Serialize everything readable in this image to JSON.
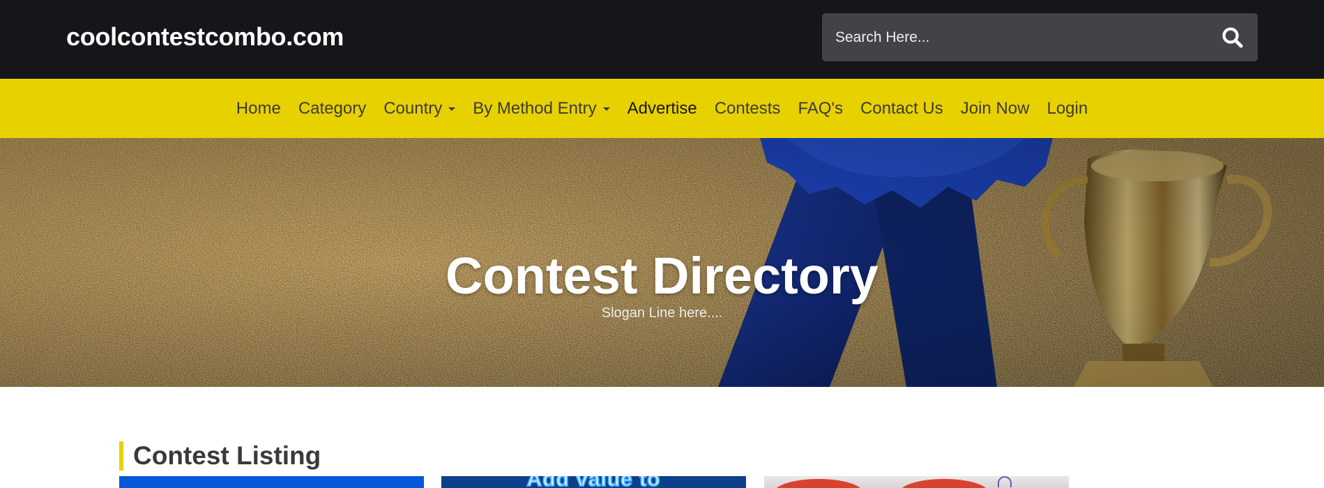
{
  "header": {
    "brand": "coolcontestcombo.com",
    "search": {
      "placeholder": "Search Here...",
      "button_icon": "search-icon"
    }
  },
  "nav": {
    "items": [
      {
        "label": "Home"
      },
      {
        "label": "Category"
      },
      {
        "label": "Country",
        "dropdown": true
      },
      {
        "label": "By Method Entry",
        "dropdown": true
      },
      {
        "label": "Advertise"
      },
      {
        "label": "Contests"
      },
      {
        "label": "FAQ's"
      },
      {
        "label": "Contact Us"
      },
      {
        "label": "Join Now"
      },
      {
        "label": "Login"
      }
    ]
  },
  "hero": {
    "title": "Contest Directory",
    "slogan": "Slogan Line here....",
    "image": "gold-glitter-blue-ribbon-trophy"
  },
  "listing": {
    "heading": "Contest Listing",
    "cards": [
      {
        "image": "contest-thumbnail-blue"
      },
      {
        "image": "contest-thumbnail-add-value",
        "wordmark": "Add value to"
      },
      {
        "image": "contest-thumbnail-red-badges"
      }
    ]
  },
  "colors": {
    "topbar": "#15161a",
    "nav_bar": "#e8d100",
    "search_bg": "#424347",
    "heading_accent": "#e8d100",
    "ribbon": "#1a3fa0",
    "gold": "#b48a3c"
  }
}
